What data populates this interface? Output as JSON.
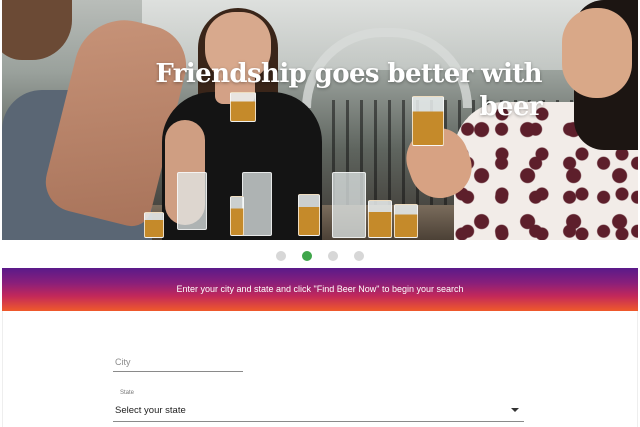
{
  "hero": {
    "title": "Friendship goes better with beer",
    "image_alt": "friends-toasting-beer-photo",
    "slides": [
      {
        "active": false
      },
      {
        "active": true
      },
      {
        "active": false
      },
      {
        "active": false
      }
    ]
  },
  "banner": {
    "text": "Enter your city and state and click \"Find Beer Now\" to begin your search"
  },
  "form": {
    "city": {
      "placeholder": "City",
      "value": ""
    },
    "state": {
      "label": "State",
      "selected": "Select your state"
    }
  },
  "colors": {
    "active_dot": "#3fa64b",
    "inactive_dot": "#d7d7d7",
    "banner_top": "#5a1a8a",
    "banner_bottom": "#f05a2a"
  }
}
